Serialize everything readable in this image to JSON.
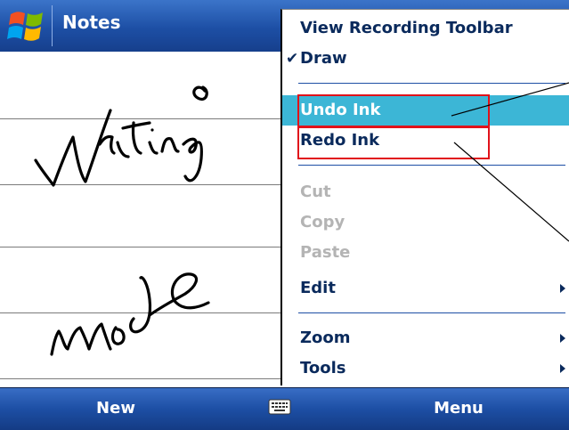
{
  "title_bar": {
    "app_title": "Notes"
  },
  "menu": {
    "items": [
      {
        "label": "View Recording Toolbar",
        "enabled": true
      },
      {
        "label": "Draw",
        "enabled": true,
        "checked": true
      },
      {
        "label": "Undo Ink",
        "enabled": true,
        "highlighted": true
      },
      {
        "label": "Redo Ink",
        "enabled": true
      },
      {
        "label": "Cut",
        "enabled": false
      },
      {
        "label": "Copy",
        "enabled": false
      },
      {
        "label": "Paste",
        "enabled": false
      },
      {
        "label": "Edit",
        "enabled": true,
        "submenu": true
      },
      {
        "label": "Zoom",
        "enabled": true,
        "submenu": true
      },
      {
        "label": "Tools",
        "enabled": true,
        "submenu": true
      }
    ],
    "check_glyph": "✔"
  },
  "command_bar": {
    "left_softkey": "New",
    "right_softkey": "Menu",
    "center_icon": "keyboard-icon"
  },
  "colors": {
    "title_bar": "#1d4fa5",
    "highlight": "#3cb6d6",
    "menu_text": "#0a2a5c",
    "disabled_text": "#b4b4b4",
    "annotation": "#e1121a"
  }
}
